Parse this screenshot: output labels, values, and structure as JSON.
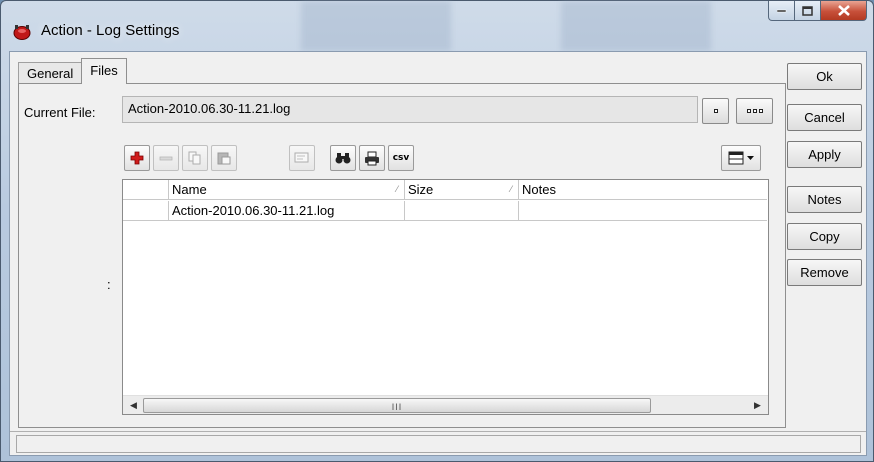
{
  "window": {
    "title": "Action - Log Settings"
  },
  "tabs": [
    {
      "label": "General",
      "active": false
    },
    {
      "label": "Files",
      "active": true
    }
  ],
  "current_file": {
    "label": "Current File:",
    "value": "Action-2010.06.30-11.21.log"
  },
  "toolbar": {
    "icons": [
      "add-icon",
      "remove-icon",
      "copy-icon",
      "paste-icon",
      "comment-icon",
      "find-icon",
      "print-icon",
      "csv-export-icon"
    ],
    "csv_label": "csv"
  },
  "grid": {
    "columns": [
      "Name",
      "Size",
      "Notes"
    ],
    "rows": [
      {
        "name": "Action-2010.06.30-11.21.log",
        "size": "",
        "notes": ""
      }
    ],
    "scroll_grip": "III"
  },
  "side_colon": ":",
  "buttons": {
    "ok": "Ok",
    "cancel": "Cancel",
    "apply": "Apply",
    "notes": "Notes",
    "copy": "Copy",
    "remove": "Remove"
  },
  "colors": {
    "add_red": "#d01c1c",
    "close_red": "#c7503a"
  }
}
